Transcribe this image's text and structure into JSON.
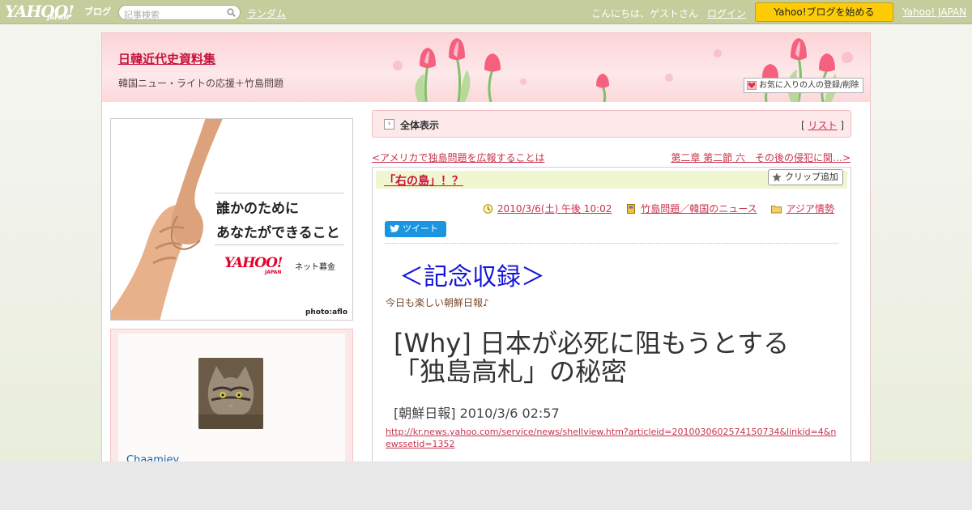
{
  "topbar": {
    "logo_text": "YAHOO!",
    "logo_sub": "JAPAN",
    "logo_product": "ブログ",
    "search_placeholder": "記事検索",
    "random_link": "ランダム",
    "greeting": "こんにちは、ゲストさん",
    "login_link": "ログイン",
    "start_button": "Yahoo!ブログを始める",
    "yahoo_japan_link": "Yahoo! JAPAN"
  },
  "blog": {
    "title": "日韓近代史資料集",
    "subtitle": "韓国ニュー・ライトの応援＋竹島問題",
    "favorite_button": "お気に入りの人の登録/削除"
  },
  "sidebar": {
    "ad": {
      "line1": "誰かのために",
      "line2": "あなたができること",
      "brand": "YAHOO!",
      "brand_sub": "JAPAN",
      "service": "ネット募金",
      "credit": "photo:aflo"
    },
    "profile": {
      "username": "Chaamiey"
    }
  },
  "viewbar": {
    "label": "全体表示",
    "list_prefix": "[ ",
    "list_link": "リスト",
    "list_suffix": " ]"
  },
  "nav": {
    "prev": "<アメリカで独島問題を広報することは",
    "next": "第二章 第二節 六　その後の侵犯に関…>"
  },
  "article": {
    "title": "「右の島」！？",
    "clip_button": "クリップ追加",
    "datetime": "2010/3/6(土) 午後 10:02",
    "category": "竹島問題／韓国のニュース",
    "folder": "アジア情勢",
    "tweet_button": "ツイート",
    "heading": "＜記念収録＞",
    "intro": "今日も楽しい朝鮮日報♪",
    "headline": "[Why] 日本が必死に阻もうとする「独島高札」の秘密",
    "dateline": "[朝鮮日報] 2010/3/6 02:57",
    "url": "http://kr.news.yahoo.com/service/news/shellview.htm?articleid=2010030602574150734&linkid=4&newssetid=1352"
  },
  "colors": {
    "topbar": "#c6cd9c",
    "start_button": "#fdcc07",
    "accent_link": "#c8344c",
    "title_red": "#c8123c",
    "heading_blue": "#1414d8",
    "tweet_blue": "#1b95e0"
  }
}
